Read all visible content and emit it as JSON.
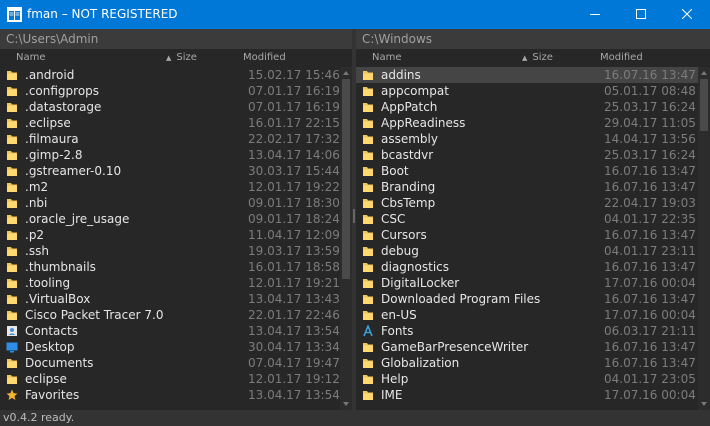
{
  "window": {
    "title": "fman – NOT REGISTERED"
  },
  "left": {
    "path": "C:\\Users\\Admin",
    "columns": {
      "name": "Name",
      "size": "Size",
      "modified": "Modified"
    },
    "rows": [
      {
        "name": ".android",
        "modified": "15.02.17 15:46",
        "icon": "folder-icon"
      },
      {
        "name": ".configprops",
        "modified": "07.01.17 16:19",
        "icon": "folder-icon"
      },
      {
        "name": ".datastorage",
        "modified": "07.01.17 16:19",
        "icon": "folder-icon"
      },
      {
        "name": ".eclipse",
        "modified": "16.01.17 22:15",
        "icon": "folder-icon"
      },
      {
        "name": ".filmaura",
        "modified": "22.02.17 17:32",
        "icon": "folder-icon"
      },
      {
        "name": ".gimp-2.8",
        "modified": "13.04.17 14:06",
        "icon": "folder-icon"
      },
      {
        "name": ".gstreamer-0.10",
        "modified": "30.03.17 15:44",
        "icon": "folder-icon"
      },
      {
        "name": ".m2",
        "modified": "12.01.17 19:22",
        "icon": "folder-icon"
      },
      {
        "name": ".nbi",
        "modified": "09.01.17 18:30",
        "icon": "folder-icon"
      },
      {
        "name": ".oracle_jre_usage",
        "modified": "09.01.17 18:24",
        "icon": "folder-icon"
      },
      {
        "name": ".p2",
        "modified": "11.04.17 12:09",
        "icon": "folder-icon"
      },
      {
        "name": ".ssh",
        "modified": "19.03.17 13:59",
        "icon": "folder-icon"
      },
      {
        "name": ".thumbnails",
        "modified": "16.01.17 18:58",
        "icon": "folder-icon"
      },
      {
        "name": ".tooling",
        "modified": "12.01.17 19:21",
        "icon": "folder-icon"
      },
      {
        "name": ".VirtualBox",
        "modified": "13.04.17 13:43",
        "icon": "folder-icon"
      },
      {
        "name": "Cisco Packet Tracer 7.0",
        "modified": "22.01.17 22:46",
        "icon": "folder-icon"
      },
      {
        "name": "Contacts",
        "modified": "13.04.17 13:54",
        "icon": "contacts-icon"
      },
      {
        "name": "Desktop",
        "modified": "30.04.17 13:34",
        "icon": "desktop-icon"
      },
      {
        "name": "Documents",
        "modified": "07.04.17 19:47",
        "icon": "folder-icon"
      },
      {
        "name": "eclipse",
        "modified": "12.01.17 19:12",
        "icon": "folder-icon"
      },
      {
        "name": "Favorites",
        "modified": "13.04.17 13:54",
        "icon": "star-icon"
      }
    ]
  },
  "right": {
    "path": "C:\\Windows",
    "columns": {
      "name": "Name",
      "size": "Size",
      "modified": "Modified"
    },
    "rows": [
      {
        "name": "addins",
        "modified": "16.07.16 13:47",
        "icon": "folder-icon",
        "selected": true
      },
      {
        "name": "appcompat",
        "modified": "05.01.17 08:48",
        "icon": "folder-icon"
      },
      {
        "name": "AppPatch",
        "modified": "25.03.17 16:24",
        "icon": "folder-icon"
      },
      {
        "name": "AppReadiness",
        "modified": "29.04.17 11:05",
        "icon": "folder-icon"
      },
      {
        "name": "assembly",
        "modified": "14.04.17 13:56",
        "icon": "folder-icon"
      },
      {
        "name": "bcastdvr",
        "modified": "25.03.17 16:24",
        "icon": "folder-icon"
      },
      {
        "name": "Boot",
        "modified": "16.07.16 13:47",
        "icon": "folder-icon"
      },
      {
        "name": "Branding",
        "modified": "16.07.16 13:47",
        "icon": "folder-icon"
      },
      {
        "name": "CbsTemp",
        "modified": "22.04.17 19:03",
        "icon": "folder-icon"
      },
      {
        "name": "CSC",
        "modified": "04.01.17 22:35",
        "icon": "folder-icon"
      },
      {
        "name": "Cursors",
        "modified": "16.07.16 13:47",
        "icon": "folder-icon"
      },
      {
        "name": "debug",
        "modified": "04.01.17 23:11",
        "icon": "folder-icon"
      },
      {
        "name": "diagnostics",
        "modified": "16.07.16 13:47",
        "icon": "folder-icon"
      },
      {
        "name": "DigitalLocker",
        "modified": "17.07.16 00:04",
        "icon": "folder-icon"
      },
      {
        "name": "Downloaded Program Files",
        "modified": "16.07.16 13:47",
        "icon": "folder-icon"
      },
      {
        "name": "en-US",
        "modified": "17.07.16 00:04",
        "icon": "folder-icon"
      },
      {
        "name": "Fonts",
        "modified": "06.03.17 21:11",
        "icon": "fonts-icon"
      },
      {
        "name": "GameBarPresenceWriter",
        "modified": "16.07.16 13:47",
        "icon": "folder-icon"
      },
      {
        "name": "Globalization",
        "modified": "16.07.16 13:47",
        "icon": "folder-icon"
      },
      {
        "name": "Help",
        "modified": "04.01.17 23:05",
        "icon": "folder-icon"
      },
      {
        "name": "IME",
        "modified": "17.07.16 00:04",
        "icon": "folder-icon"
      }
    ]
  },
  "status": {
    "text": "v0.4.2 ready."
  },
  "colors": {
    "titlebar": "#0078d7",
    "background": "#272727",
    "folder": "#f4c45a",
    "selected_row": "#454545"
  }
}
